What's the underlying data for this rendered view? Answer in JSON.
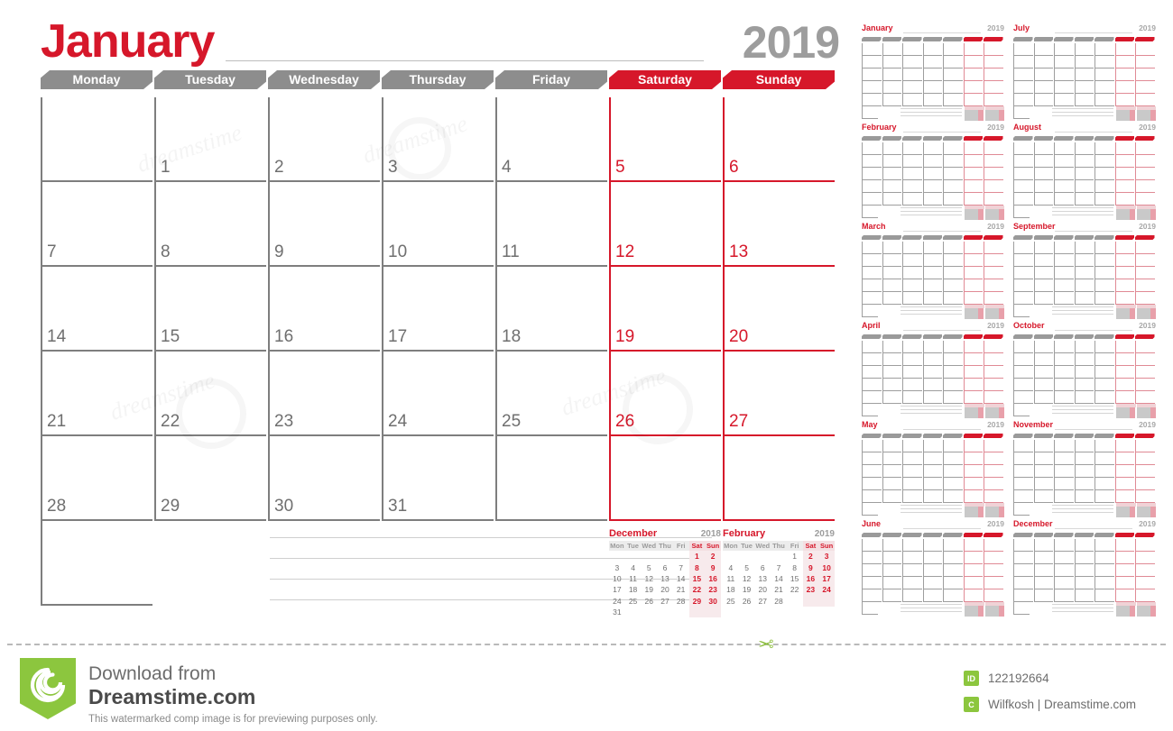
{
  "main": {
    "month": "January",
    "year": "2019",
    "day_headers": [
      {
        "label": "Monday",
        "weekend": false
      },
      {
        "label": "Tuesday",
        "weekend": false
      },
      {
        "label": "Wednesday",
        "weekend": false
      },
      {
        "label": "Thursday",
        "weekend": false
      },
      {
        "label": "Friday",
        "weekend": false
      },
      {
        "label": "Saturday",
        "weekend": true
      },
      {
        "label": "Sunday",
        "weekend": true
      }
    ],
    "weeks": [
      [
        "",
        "1",
        "2",
        "3",
        "4",
        "5",
        "6"
      ],
      [
        "7",
        "8",
        "9",
        "10",
        "11",
        "12",
        "13"
      ],
      [
        "14",
        "15",
        "16",
        "17",
        "18",
        "19",
        "20"
      ],
      [
        "21",
        "22",
        "23",
        "24",
        "25",
        "26",
        "27"
      ],
      [
        "28",
        "29",
        "30",
        "31",
        "",
        "",
        ""
      ]
    ],
    "note_lines": 4
  },
  "mini_calendars": [
    {
      "month": "December",
      "year": "2018",
      "dow": [
        "Mon",
        "Tue",
        "Wed",
        "Thu",
        "Fri",
        "Sat",
        "Sun"
      ],
      "weeks": [
        [
          "",
          "",
          "",
          "",
          "",
          "1",
          "2"
        ],
        [
          "3",
          "4",
          "5",
          "6",
          "7",
          "8",
          "9"
        ],
        [
          "10",
          "11",
          "12",
          "13",
          "14",
          "15",
          "16"
        ],
        [
          "17",
          "18",
          "19",
          "20",
          "21",
          "22",
          "23"
        ],
        [
          "24",
          "25",
          "26",
          "27",
          "28",
          "29",
          "30"
        ],
        [
          "31",
          "",
          "",
          "",
          "",
          "",
          ""
        ]
      ]
    },
    {
      "month": "February",
      "year": "2019",
      "dow": [
        "Mon",
        "Tue",
        "Wed",
        "Thu",
        "Fri",
        "Sat",
        "Sun"
      ],
      "weeks": [
        [
          "",
          "",
          "",
          "",
          "1",
          "2",
          "3"
        ],
        [
          "4",
          "5",
          "6",
          "7",
          "8",
          "9",
          "10"
        ],
        [
          "11",
          "12",
          "13",
          "14",
          "15",
          "16",
          "17"
        ],
        [
          "18",
          "19",
          "20",
          "21",
          "22",
          "23",
          "24"
        ],
        [
          "25",
          "26",
          "27",
          "28",
          "",
          "",
          ""
        ]
      ]
    }
  ],
  "thumbnails": [
    {
      "month": "January",
      "year": "2019",
      "weeks": 5
    },
    {
      "month": "July",
      "year": "2019",
      "weeks": 5
    },
    {
      "month": "February",
      "year": "2019",
      "weeks": 5
    },
    {
      "month": "August",
      "year": "2019",
      "weeks": 5
    },
    {
      "month": "March",
      "year": "2019",
      "weeks": 5
    },
    {
      "month": "September",
      "year": "2019",
      "weeks": 5
    },
    {
      "month": "April",
      "year": "2019",
      "weeks": 5
    },
    {
      "month": "October",
      "year": "2019",
      "weeks": 5
    },
    {
      "month": "May",
      "year": "2019",
      "weeks": 5
    },
    {
      "month": "November",
      "year": "2019",
      "weeks": 5
    },
    {
      "month": "June",
      "year": "2019",
      "weeks": 5
    },
    {
      "month": "December",
      "year": "2019",
      "weeks": 5
    }
  ],
  "watermark": {
    "text": "dreamstime",
    "logo_name": "dreamstime-spiral-watermark"
  },
  "footer": {
    "line1": "Download from",
    "line2": "Dreamstime.com",
    "line3": "This watermarked comp image is for previewing purposes only.",
    "id_label": "ID",
    "id_value": "122192664",
    "copyright_label": "C",
    "author": "Wilfkosh | Dreamstime.com"
  },
  "colors": {
    "red": "#d6172a",
    "gray": "#8d8d8d",
    "green": "#8cc63e",
    "cell_border": "#7e7e7e"
  }
}
